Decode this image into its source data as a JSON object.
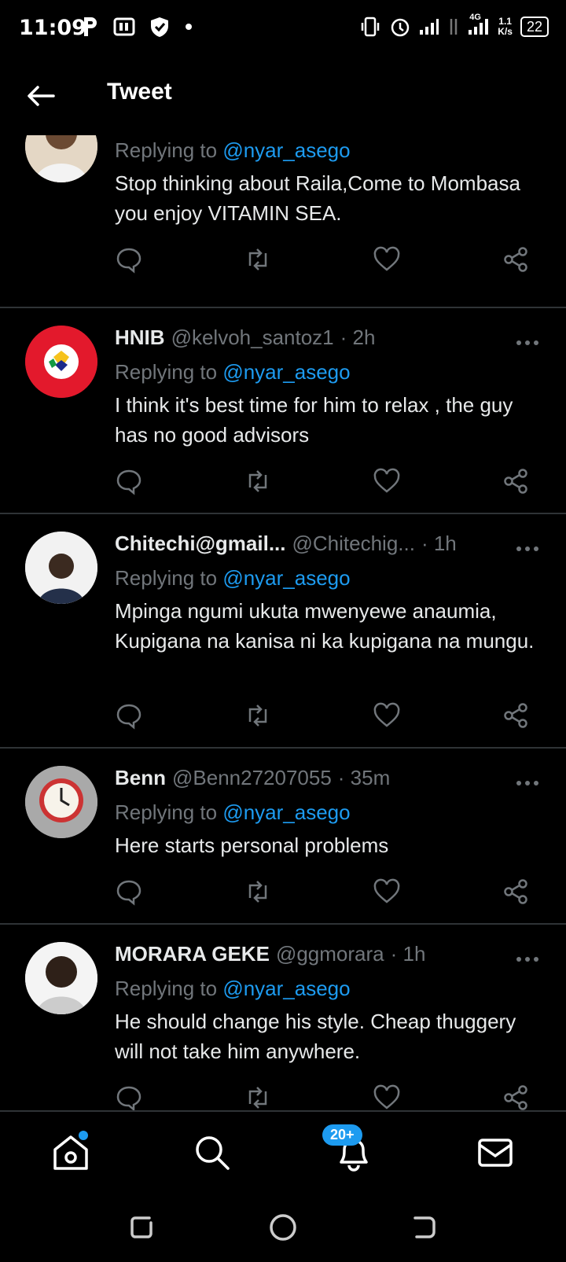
{
  "status_bar": {
    "time": "11:09",
    "network": "4G",
    "speed_value": "1.1",
    "speed_unit": "K/s",
    "battery": "22"
  },
  "header": {
    "title": "Tweet"
  },
  "tweets": [
    {
      "name": "",
      "handle": "",
      "time": "",
      "replying_prefix": "Replying to",
      "replying_to": "@nyar_asego",
      "text": "Stop thinking about Raila,Come to Mombasa you enjoy VITAMIN SEA."
    },
    {
      "name": "HNIB",
      "handle": "@kelvoh_santoz1",
      "time": "· 2h",
      "replying_prefix": "Replying to",
      "replying_to": "@nyar_asego",
      "text": "I think it's best time for him to relax , the guy has no good advisors"
    },
    {
      "name": "Chitechi@gmail...",
      "handle": "@Chitechig...",
      "time": "· 1h",
      "replying_prefix": "Replying to",
      "replying_to": "@nyar_asego",
      "text": "Mpinga ngumi ukuta mwenyewe anaumia, Kupigana na kanisa ni ka kupigana na mungu."
    },
    {
      "name": "Benn",
      "handle": "@Benn27207055",
      "time": "· 35m",
      "replying_prefix": "Replying to",
      "replying_to": "@nyar_asego",
      "text": "Here starts personal problems"
    },
    {
      "name": "MORARA GEKE",
      "handle": "@ggmorara",
      "time": "· 1h",
      "replying_prefix": "Replying to",
      "replying_to": "@nyar_asego",
      "text": "He should change his style. Cheap thuggery will not take him anywhere."
    }
  ],
  "bottom_nav": {
    "notifications_badge": "20+"
  },
  "colors": {
    "accent": "#1d9bf0",
    "background": "#000000",
    "secondary_text": "#71767b"
  }
}
